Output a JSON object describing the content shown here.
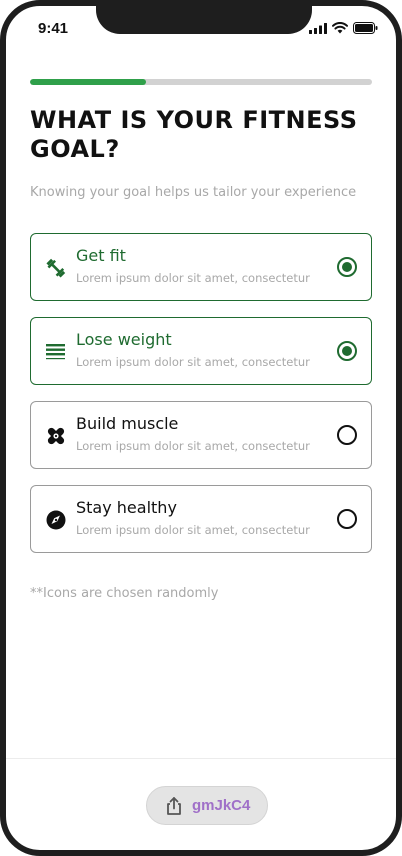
{
  "status_bar": {
    "time": "9:41",
    "icons": [
      "signal-icon",
      "wifi-icon",
      "battery-icon"
    ]
  },
  "progress": {
    "fraction": 0.34
  },
  "title": "WHAT IS YOUR FITNESS GOAL?",
  "subtitle": "Knowing your goal helps us tailor your experience",
  "options": [
    {
      "label": "Get fit",
      "description": "Lorem ipsum dolor sit amet, consectetur",
      "icon": "dumbbell-icon",
      "selected": true
    },
    {
      "label": "Lose weight",
      "description": "Lorem ipsum dolor sit amet, consectetur",
      "icon": "lines-icon",
      "selected": true
    },
    {
      "label": "Build muscle",
      "description": "Lorem ipsum dolor sit amet, consectetur",
      "icon": "bandage-icon",
      "selected": false
    },
    {
      "label": "Stay healthy",
      "description": "Lorem ipsum dolor sit amet, consectetur",
      "icon": "compass-icon",
      "selected": false
    }
  ],
  "footnote": "**Icons are chosen randomly",
  "share": {
    "code": "gmJkC4",
    "icon": "share-icon"
  },
  "colors": {
    "accent": "#1f6b30",
    "progress": "#2fa04a",
    "share_text": "#a070c8"
  }
}
